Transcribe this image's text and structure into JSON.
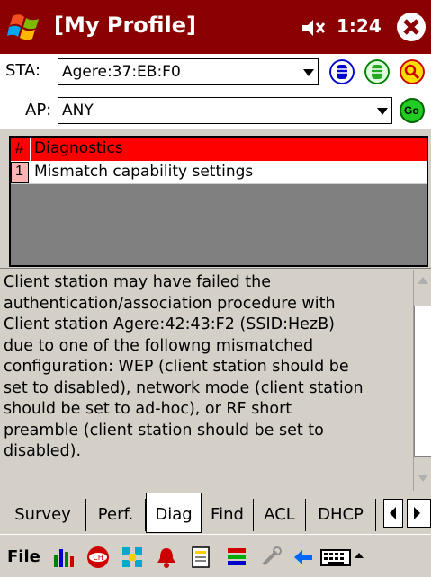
{
  "titlebar": {
    "title": "[My Profile]",
    "time": "1:24",
    "icons": [
      "windows-start-icon",
      "volume-muted-icon",
      "close-icon"
    ]
  },
  "sta": {
    "label": "STA:",
    "value": "Agere:37:EB:F0",
    "icons": [
      "blue-db-icon",
      "green-db-icon",
      "yellow-search-icon"
    ]
  },
  "ap": {
    "label": "AP:",
    "value": "ANY",
    "go_label": "Go"
  },
  "diagnostics": {
    "header_num": "#",
    "header_title": "Diagnostics",
    "rows": [
      {
        "num": "1",
        "text": "Mismatch capability settings"
      }
    ]
  },
  "description": {
    "lines": [
      "Client station may have failed the",
      "authentication/association procedure with",
      "Client station Agere:42:43:F2 (SSID:HezB)",
      "due to one of the followng mismatched",
      "configuration: WEP (client station should be",
      "set to disabled), network mode (client station",
      "should be set to ad-hoc), or RF short",
      "preamble (client station should be set to",
      "disabled)."
    ]
  },
  "tabs": [
    {
      "label": "Survey",
      "active": false
    },
    {
      "label": "Perf.",
      "active": false
    },
    {
      "label": "Diag",
      "active": true
    },
    {
      "label": "Find",
      "active": false
    },
    {
      "label": "ACL",
      "active": false
    },
    {
      "label": "DHCP",
      "active": false
    }
  ],
  "menubar": {
    "file_label": "File",
    "icons": [
      "bar-graph-icon",
      "channel-icon",
      "network-icon",
      "alarm-bell-icon",
      "notes-icon",
      "color-bars-icon",
      "tools-icon",
      "back-arrow-icon",
      "keyboard-icon"
    ]
  },
  "colors": {
    "titlebar_bg": "#8b0000",
    "header_red": "#ff0000",
    "row_num_bg": "#ffb3b3",
    "panel_gray": "#d4d0c8"
  }
}
